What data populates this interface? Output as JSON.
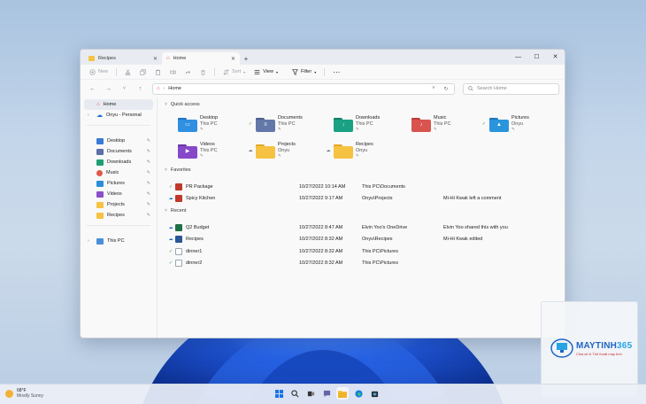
{
  "colors": {
    "accent": "#0067c0",
    "wallpaper_blue": "#1a4fd1",
    "sync_green": "#2e9a3e",
    "folder_yellow": "#f5c242"
  },
  "window": {
    "tabs": [
      {
        "label": "Recipes",
        "icon": "folder-icon"
      },
      {
        "label": "Home",
        "icon": "home-icon"
      }
    ],
    "new_tab_label": "+",
    "controls": {
      "minimize": "—",
      "maximize": "☐",
      "close": "✕"
    }
  },
  "toolbar": {
    "new_label": "New",
    "sort_label": "Sort",
    "view_label": "View",
    "filter_label": "Filter",
    "more_label": "⋯"
  },
  "address": {
    "path": "Home",
    "search_placeholder": "Search Home"
  },
  "sidebar": {
    "top": [
      {
        "label": "Home",
        "icon": "home-icon",
        "selected": true
      },
      {
        "label": "Onyu - Personal",
        "icon": "cloud-icon",
        "chevron": "›"
      }
    ],
    "pinned": [
      {
        "label": "Desktop",
        "icon": "desktop-icon",
        "color": "#3a7bd5"
      },
      {
        "label": "Documents",
        "icon": "documents-icon",
        "color": "#5b6fa8"
      },
      {
        "label": "Downloads",
        "icon": "downloads-icon",
        "color": "#1f9e76"
      },
      {
        "label": "Music",
        "icon": "music-icon",
        "color": "#e0584d"
      },
      {
        "label": "Pictures",
        "icon": "pictures-icon",
        "color": "#2a8fd8"
      },
      {
        "label": "Videos",
        "icon": "videos-icon",
        "color": "#8a4fc9"
      },
      {
        "label": "Projects",
        "icon": "folder-icon",
        "color": "#f5c242"
      },
      {
        "label": "Recipes",
        "icon": "folder-icon",
        "color": "#f5c242"
      }
    ],
    "this_pc": {
      "label": "This PC",
      "icon": "pc-icon",
      "chevron": "›"
    }
  },
  "quick_access": {
    "title": "Quick access",
    "items": [
      {
        "name": "Desktop",
        "sub": "This PC",
        "color": "#2f8fe0",
        "glyph": "▭",
        "status": ""
      },
      {
        "name": "Documents",
        "sub": "This PC",
        "color": "#6378a8",
        "glyph": "≡",
        "status": "✓"
      },
      {
        "name": "Downloads",
        "sub": "This PC",
        "color": "#1aa082",
        "glyph": "↓",
        "status": ""
      },
      {
        "name": "Music",
        "sub": "This PC",
        "color": "#d9534f",
        "glyph": "♪",
        "status": ""
      },
      {
        "name": "Pictures",
        "sub": "Onyu",
        "color": "#2a95dd",
        "glyph": "▲",
        "status": "✓"
      },
      {
        "name": "Videos",
        "sub": "This PC",
        "color": "#8648c9",
        "glyph": "▶",
        "status": ""
      },
      {
        "name": "Projects",
        "sub": "Onyu",
        "color": "#f5c242",
        "glyph": "",
        "status": "☁"
      },
      {
        "name": "Recipes",
        "sub": "Onyu",
        "color": "#f5c242",
        "glyph": "",
        "status": "☁"
      }
    ]
  },
  "favorites": {
    "title": "Favorites",
    "rows": [
      {
        "name": "PR Package",
        "date": "10/27/2022 10:14 AM",
        "location": "This PC\\Documents",
        "activity": "",
        "status": "✓",
        "icon_color": "#c0392b"
      },
      {
        "name": "Spicy Kitchen",
        "date": "10/27/2022 9:17 AM",
        "location": "Onyu\\Projects",
        "activity": "Mi-Hi Kwak left a comment",
        "status": "☁",
        "icon_color": "#c0392b"
      }
    ]
  },
  "recent": {
    "title": "Recent",
    "rows": [
      {
        "name": "Q2 Budget",
        "date": "10/27/2022 8:47 AM",
        "location": "Elvin Yoo's OneDrive",
        "activity": "Elvin Yoo shared this with you",
        "status": "☁",
        "icon_color": "#1e7145"
      },
      {
        "name": "Recipes",
        "date": "10/27/2022 8:32 AM",
        "location": "Onyu\\Recipes",
        "activity": "Mi-Hi Kwak edited",
        "status": "☁",
        "icon_color": "#2b5797"
      },
      {
        "name": "dinner1",
        "date": "10/27/2022 8:32 AM",
        "location": "This PC\\Pictures",
        "activity": "",
        "status": "✓",
        "icon_color": "#9aa6b2"
      },
      {
        "name": "dinner2",
        "date": "10/27/2022 8:32 AM",
        "location": "This PC\\Pictures",
        "activity": "",
        "status": "✓",
        "icon_color": "#9aa6b2"
      }
    ]
  },
  "taskbar": {
    "weather_temp": "68°F",
    "weather_desc": "Mostly Sunny",
    "apps": [
      "windows-start-icon",
      "search-icon",
      "task-view-icon",
      "chat-icon",
      "file-explorer-icon",
      "edge-icon",
      "store-icon"
    ]
  },
  "watermark": {
    "brand_prefix": "MAYTINH",
    "brand_number": "365",
    "tagline": "Chia sẻ & Thủ thuật máy tính"
  }
}
